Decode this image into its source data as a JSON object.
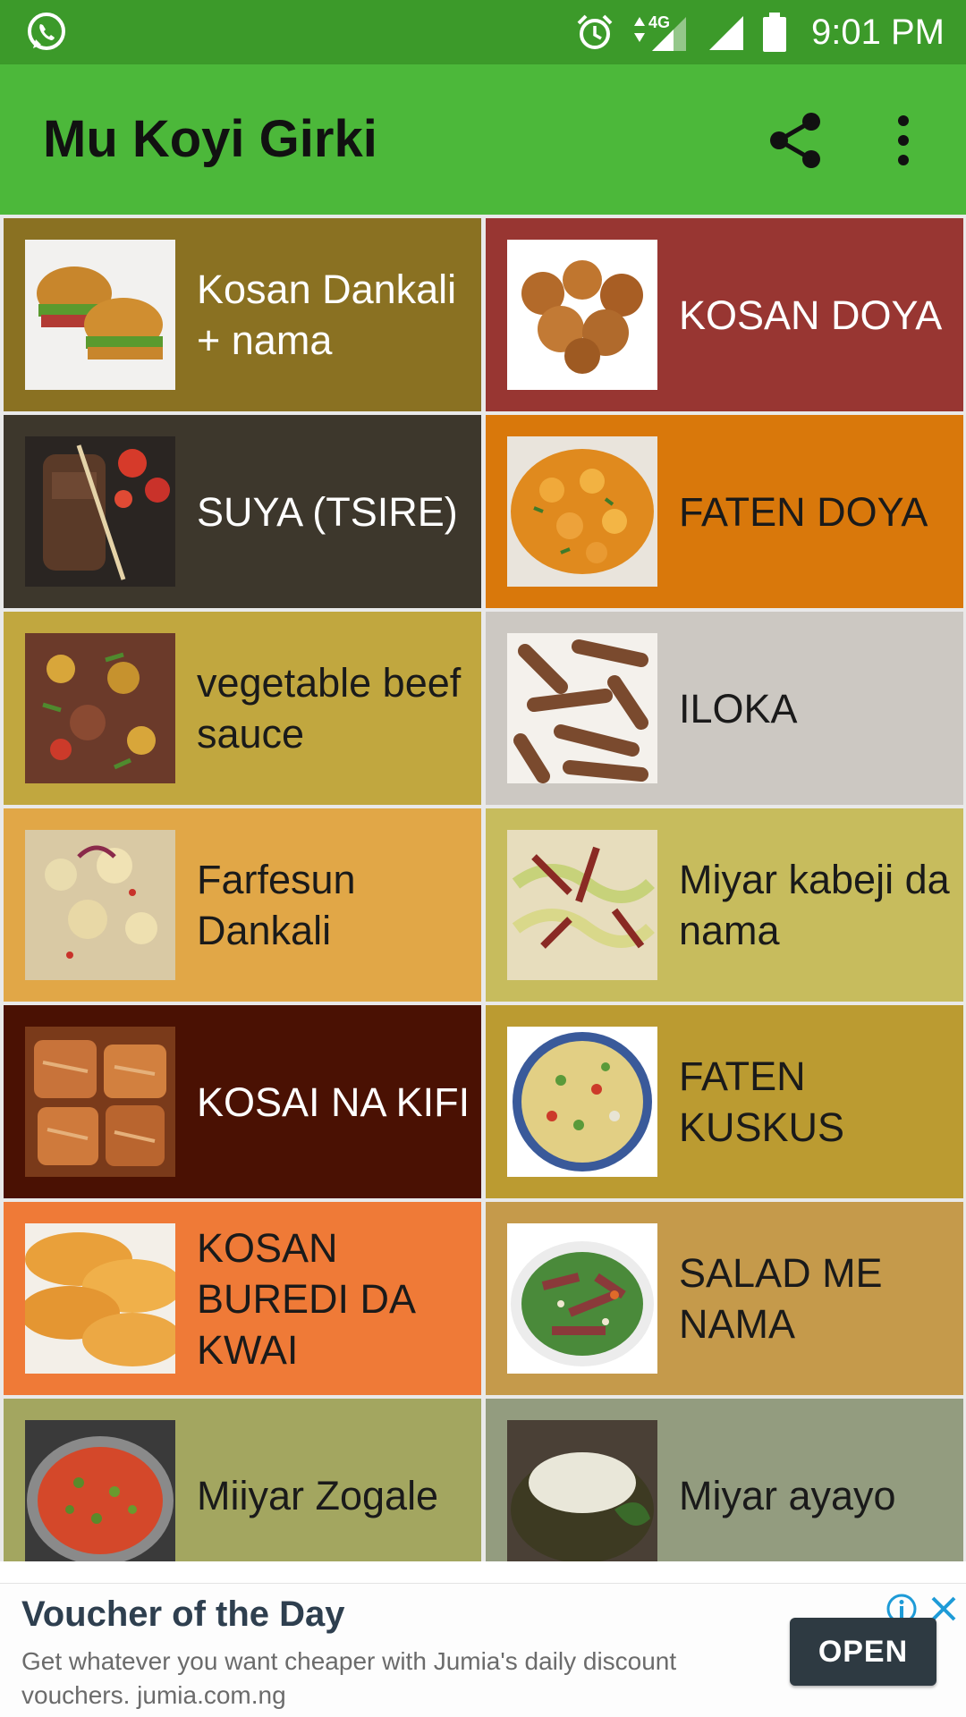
{
  "status_bar": {
    "time": "9:01 PM",
    "network": "4G",
    "icons": [
      "whatsapp-icon",
      "alarm-icon",
      "signal-4g-icon",
      "signal-icon",
      "battery-icon"
    ]
  },
  "app_bar": {
    "title": "Mu Koyi Girki",
    "icons": [
      "share-icon",
      "more-vert-icon"
    ]
  },
  "recipes": [
    {
      "label": "Kosan Dankali + nama",
      "bg": "#8a7122",
      "text_color": "#ffffff",
      "icon": "burger-photo"
    },
    {
      "label": "KOSAN DOYA",
      "bg": "#983632",
      "text_color": "#ffffff",
      "icon": "fried-yam-balls-photo"
    },
    {
      "label": "SUYA (TSIRE)",
      "bg": "#3d372c",
      "text_color": "#ffffff",
      "icon": "suya-skewer-photo"
    },
    {
      "label": "FATEN DOYA",
      "bg": "#d9780b",
      "text_color": "#1a1a1a",
      "icon": "yam-porridge-photo"
    },
    {
      "label": "vegetable beef sauce",
      "bg": "#c1a73f",
      "text_color": "#1a1a1a",
      "icon": "beef-sauce-photo"
    },
    {
      "label": "ILOKA",
      "bg": "#ccc8c2",
      "text_color": "#1a1a1a",
      "icon": "iloka-sticks-photo"
    },
    {
      "label": "Farfesun Dankali",
      "bg": "#e1a747",
      "text_color": "#1a1a1a",
      "icon": "potato-pepper-soup-photo"
    },
    {
      "label": "Miyar kabeji da nama",
      "bg": "#c7bc5d",
      "text_color": "#1a1a1a",
      "icon": "cabbage-stir-fry-photo"
    },
    {
      "label": "KOSAI NA KIFI",
      "bg": "#4a1103",
      "text_color": "#ffffff",
      "icon": "grilled-fish-photo"
    },
    {
      "label": "FATEN KUSKUS",
      "bg": "#bb9b31",
      "text_color": "#1a1a1a",
      "icon": "couscous-salad-photo"
    },
    {
      "label": "KOSAN BUREDI DA KWAI",
      "bg": "#ef7a37",
      "text_color": "#1a1a1a",
      "icon": "bread-fritters-photo"
    },
    {
      "label": "SALAD ME NAMA",
      "bg": "#c59a4b",
      "text_color": "#1a1a1a",
      "icon": "meat-salad-photo"
    },
    {
      "label": "Miiyar Zogale",
      "bg": "#a3a660",
      "text_color": "#1a1a1a",
      "icon": "zogale-soup-photo"
    },
    {
      "label": "Miyar ayayo",
      "bg": "#939c7f",
      "text_color": "#1a1a1a",
      "icon": "ayayo-soup-photo"
    }
  ],
  "ad": {
    "title": "Voucher of the Day",
    "description": "Get whatever you want cheaper with Jumia's daily discount vouchers. jumia.com.ng",
    "cta": "OPEN",
    "icons": [
      "info-icon",
      "close-icon"
    ]
  },
  "colors": {
    "status_bar": "#3c9a2a",
    "app_bar": "#4cb83a",
    "ad_button": "#2e3a42",
    "ad_icons": "#1e9bd7"
  }
}
